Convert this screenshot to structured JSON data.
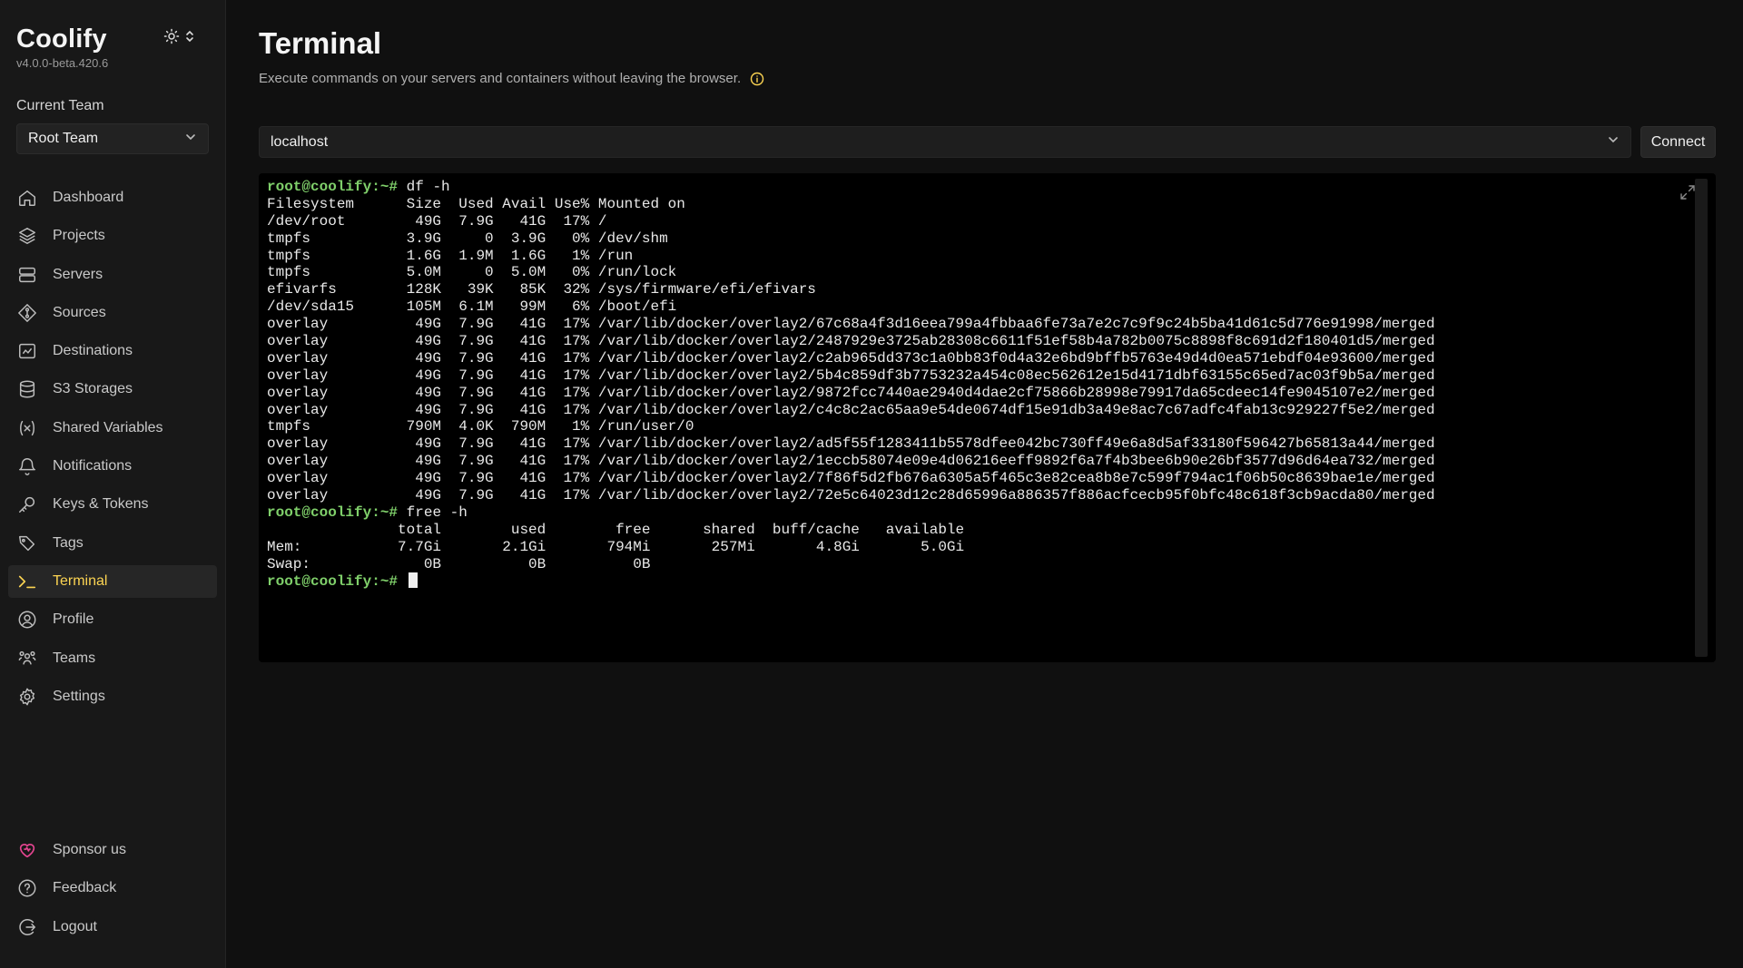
{
  "brand": {
    "name": "Coolify",
    "version": "v4.0.0-beta.420.6"
  },
  "team": {
    "label": "Current Team",
    "selected": "Root Team"
  },
  "nav": {
    "items": [
      {
        "label": "Dashboard",
        "icon": "home-icon"
      },
      {
        "label": "Projects",
        "icon": "layers-icon"
      },
      {
        "label": "Servers",
        "icon": "server-icon"
      },
      {
        "label": "Sources",
        "icon": "git-icon"
      },
      {
        "label": "Destinations",
        "icon": "destination-icon"
      },
      {
        "label": "S3 Storages",
        "icon": "database-icon"
      },
      {
        "label": "Shared Variables",
        "icon": "variable-icon"
      },
      {
        "label": "Notifications",
        "icon": "bell-icon"
      },
      {
        "label": "Keys & Tokens",
        "icon": "key-icon"
      },
      {
        "label": "Tags",
        "icon": "tag-icon"
      },
      {
        "label": "Terminal",
        "icon": "terminal-icon",
        "active": true
      },
      {
        "label": "Profile",
        "icon": "user-icon"
      },
      {
        "label": "Teams",
        "icon": "users-icon"
      },
      {
        "label": "Settings",
        "icon": "gear-icon"
      }
    ],
    "bottom": [
      {
        "label": "Sponsor us",
        "icon": "heart-icon"
      },
      {
        "label": "Feedback",
        "icon": "help-icon"
      },
      {
        "label": "Logout",
        "icon": "logout-icon"
      }
    ]
  },
  "page": {
    "title": "Terminal",
    "subtitle": "Execute commands on your servers and containers without leaving the browser."
  },
  "server_select": {
    "value": "localhost"
  },
  "connect_label": "Connect",
  "colors": {
    "accent": "#fcd452",
    "prompt": "#7fcf6a",
    "sponsor": "#e64591"
  },
  "terminal": {
    "prompt": "root@coolify:~#",
    "lines": [
      {
        "prompt": "root@coolify:~#",
        "text": " df -h"
      },
      {
        "text": "Filesystem      Size  Used Avail Use% Mounted on"
      },
      {
        "text": "/dev/root        49G  7.9G   41G  17% /"
      },
      {
        "text": "tmpfs           3.9G     0  3.9G   0% /dev/shm"
      },
      {
        "text": "tmpfs           1.6G  1.9M  1.6G   1% /run"
      },
      {
        "text": "tmpfs           5.0M     0  5.0M   0% /run/lock"
      },
      {
        "text": "efivarfs        128K   39K   85K  32% /sys/firmware/efi/efivars"
      },
      {
        "text": "/dev/sda15      105M  6.1M   99M   6% /boot/efi"
      },
      {
        "text": "overlay          49G  7.9G   41G  17% /var/lib/docker/overlay2/67c68a4f3d16eea799a4fbbaa6fe73a7e2c7c9f9c24b5ba41d61c5d776e91998/merged"
      },
      {
        "text": "overlay          49G  7.9G   41G  17% /var/lib/docker/overlay2/2487929e3725ab28308c6611f51ef58b4a782b0075c8898f8c691d2f180401d5/merged"
      },
      {
        "text": "overlay          49G  7.9G   41G  17% /var/lib/docker/overlay2/c2ab965dd373c1a0bb83f0d4a32e6bd9bffb5763e49d4d0ea571ebdf04e93600/merged"
      },
      {
        "text": "overlay          49G  7.9G   41G  17% /var/lib/docker/overlay2/5b4c859df3b7753232a454c08ec562612e15d4171dbf63155c65ed7ac03f9b5a/merged"
      },
      {
        "text": "overlay          49G  7.9G   41G  17% /var/lib/docker/overlay2/9872fcc7440ae2940d4dae2cf75866b28998e79917da65cdeec14fe9045107e2/merged"
      },
      {
        "text": "overlay          49G  7.9G   41G  17% /var/lib/docker/overlay2/c4c8c2ac65aa9e54de0674df15e91db3a49e8ac7c67adfc4fab13c929227f5e2/merged"
      },
      {
        "text": "tmpfs           790M  4.0K  790M   1% /run/user/0"
      },
      {
        "text": "overlay          49G  7.9G   41G  17% /var/lib/docker/overlay2/ad5f55f1283411b5578dfee042bc730ff49e6a8d5af33180f596427b65813a44/merged"
      },
      {
        "text": "overlay          49G  7.9G   41G  17% /var/lib/docker/overlay2/1eccb58074e09e4d06216eeff9892f6a7f4b3bee6b90e26bf3577d96d64ea732/merged"
      },
      {
        "text": "overlay          49G  7.9G   41G  17% /var/lib/docker/overlay2/7f86f5d2fb676a6305a5f465c3e82cea8b8e7c599f794ac1f06b50c8639bae1e/merged"
      },
      {
        "text": "overlay          49G  7.9G   41G  17% /var/lib/docker/overlay2/72e5c64023d12c28d65996a886357f886acfcecb95f0bfc48c618f3cb9acda80/merged"
      },
      {
        "prompt": "root@coolify:~#",
        "text": " free -h"
      },
      {
        "text": "               total        used        free      shared  buff/cache   available"
      },
      {
        "text": "Mem:           7.7Gi       2.1Gi       794Mi       257Mi       4.8Gi       5.0Gi"
      },
      {
        "text": "Swap:             0B          0B          0B"
      },
      {
        "prompt": "root@coolify:~#",
        "text": " ",
        "cursor": true
      }
    ]
  }
}
